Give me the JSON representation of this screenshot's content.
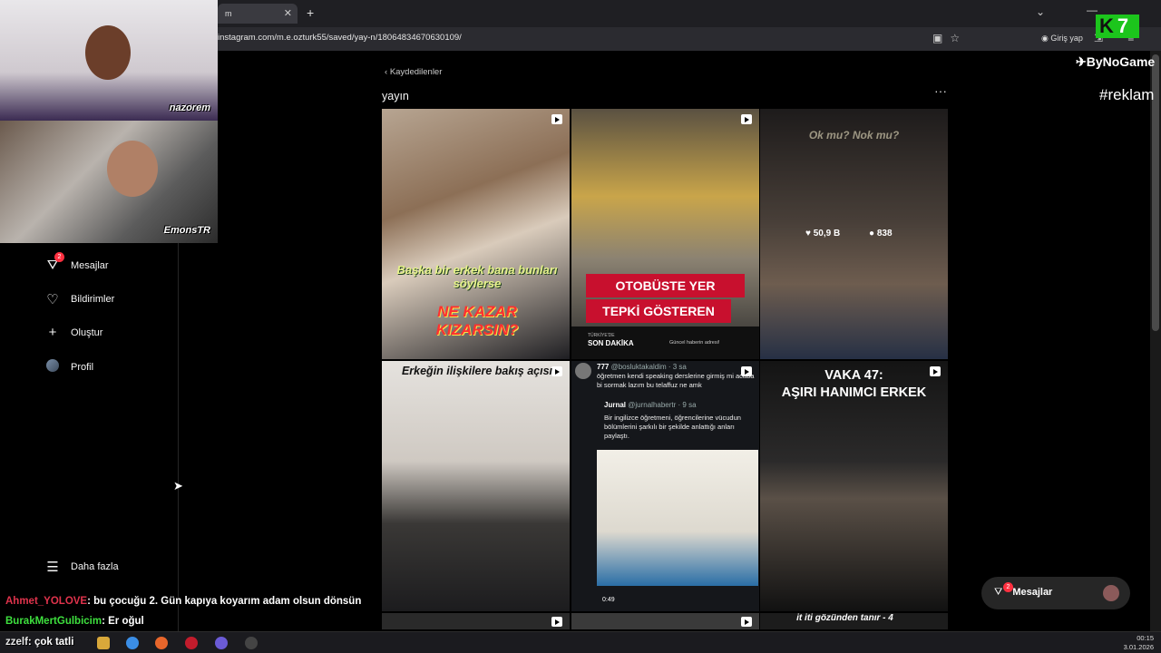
{
  "browser": {
    "tab_title": "m",
    "tab_close": "✕",
    "new_tab": "+",
    "url": "instagram.com/m.e.ozturk55/saved/yay-n/18064834670630109/",
    "login": "Giriş yap"
  },
  "sidebar": {
    "items": [
      {
        "label": "Mesajlar",
        "badge": "2",
        "icon": "messenger-icon"
      },
      {
        "label": "Bildirimler",
        "icon": "heart-icon"
      },
      {
        "label": "Oluştur",
        "icon": "plus-icon"
      },
      {
        "label": "Profil",
        "icon": "avatar"
      },
      {
        "label": "Daha fazla",
        "icon": "menu-icon"
      }
    ]
  },
  "collection": {
    "back_label": "Kaydedilenler",
    "title": "yayın",
    "more": "···"
  },
  "posts": [
    {
      "caption1": "Başka bir erkek bana bunları söylerse",
      "caption2": "NE KAZAR KIZARSIN?"
    },
    {
      "caption1": "OTOBÜSTE YER İSTEMEYE",
      "caption2": "TEPKİ GÖSTEREN GENÇ",
      "footer_left": "SON DAKİKA",
      "footer_right": "Güncel haberin adresi!",
      "footer_top": "TÜRKİYE'DE"
    },
    {
      "caption": "Ok mu? Nok mu?",
      "likes": "50,9 B",
      "comments": "838"
    },
    {
      "caption": "Erkeğin ilişkilere bakış açısı"
    },
    {
      "tweet_user": "777",
      "tweet_handle": "@bosluktakaldim · 3 sa",
      "tweet_text": "öğretmen kendi speaking derslerine girmiş mi acaba bi sormak lazım bu telaffuz ne amk",
      "quote_user": "Jurnal",
      "quote_handle": "@jurnalhabertr · 9 sa",
      "quote_text": "Bir ingilizce öğretmeni, öğrencilerine vücudun bölümlerini şarkılı bir şekilde anlattığı anları paylaştı.",
      "duration": "0:49"
    },
    {
      "caption1": "VAKA 47:",
      "caption2": "AŞIRI HANIMCI ERKEK"
    },
    {
      "caption": ""
    },
    {
      "caption": ""
    },
    {
      "caption": "it iti gözünden tanır - 4"
    }
  ],
  "overlay": {
    "cam1_name": "nazorem",
    "cam2_name": "EmonsTR",
    "brand": "ByNoGame",
    "tag": "#reklam",
    "k_logo": "K",
    "k_num": "7"
  },
  "float_messages": {
    "label": "Mesajlar",
    "badge": "2"
  },
  "chat": [
    {
      "user": "Ahmet_YOLOVE",
      "text": ": bu çocuğu 2. Gün kapıya koyarım adam olsun dönsün"
    },
    {
      "user": "BurakMertGulbicim",
      "text": ": Er oğul"
    },
    {
      "user": "zzelf",
      "text": ": çok tatli"
    }
  ],
  "taskbar": {
    "time": "00:15",
    "date": "3.01.2026"
  },
  "colors": {
    "accent_red": "#ff3040",
    "bus_red": "#c8102e",
    "chat_green": "#3ee03e"
  }
}
